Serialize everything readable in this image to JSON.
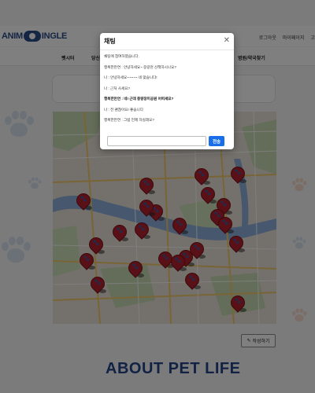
{
  "header": {
    "logo_text_left": "ANIM",
    "logo_text_right": "INGLE",
    "top_links": [
      "로그아웃",
      "마이페이지",
      "고"
    ]
  },
  "nav": {
    "items": [
      {
        "label": "펫시터"
      },
      {
        "label": "당신"
      },
      {
        "label": "병원/약국찾기"
      }
    ]
  },
  "map": {
    "pin_icon": "paw-marker-icon",
    "pin_color": "#b3232e",
    "pin_count": 28
  },
  "write_button": {
    "icon": "pencil-icon",
    "label": "작성하기"
  },
  "about_heading": "ABOUT PET LIFE",
  "chat_modal": {
    "title": "채팅",
    "close_icon": "close-icon",
    "messages": [
      {
        "text": "채팅에 참여하였습니다.",
        "bold": false
      },
      {
        "text": "행복한만연 : 안녕하세요~ 중랑천 산책하시나요?",
        "bold": false
      },
      {
        "text": "나 : 안녕하세요~~~~~ 네 맞습니다!",
        "bold": false
      },
      {
        "text": "나 : 근처 사세요?",
        "bold": false
      },
      {
        "text": "행복한만연 : 네! 근데 중랑장미공원 어떠세요?",
        "bold": true
      },
      {
        "text": "나 : 전 괜찮아요! 좋습니다",
        "bold": false
      },
      {
        "text": "행복한만연 : 그럼 언제 하실래요?",
        "bold": false
      }
    ],
    "input_placeholder": "",
    "send_label": "전송"
  },
  "colors": {
    "brand_blue": "#2b4a88",
    "send_button": "#1a6fe8",
    "overlay": "rgba(0,0,0,0.5)"
  }
}
